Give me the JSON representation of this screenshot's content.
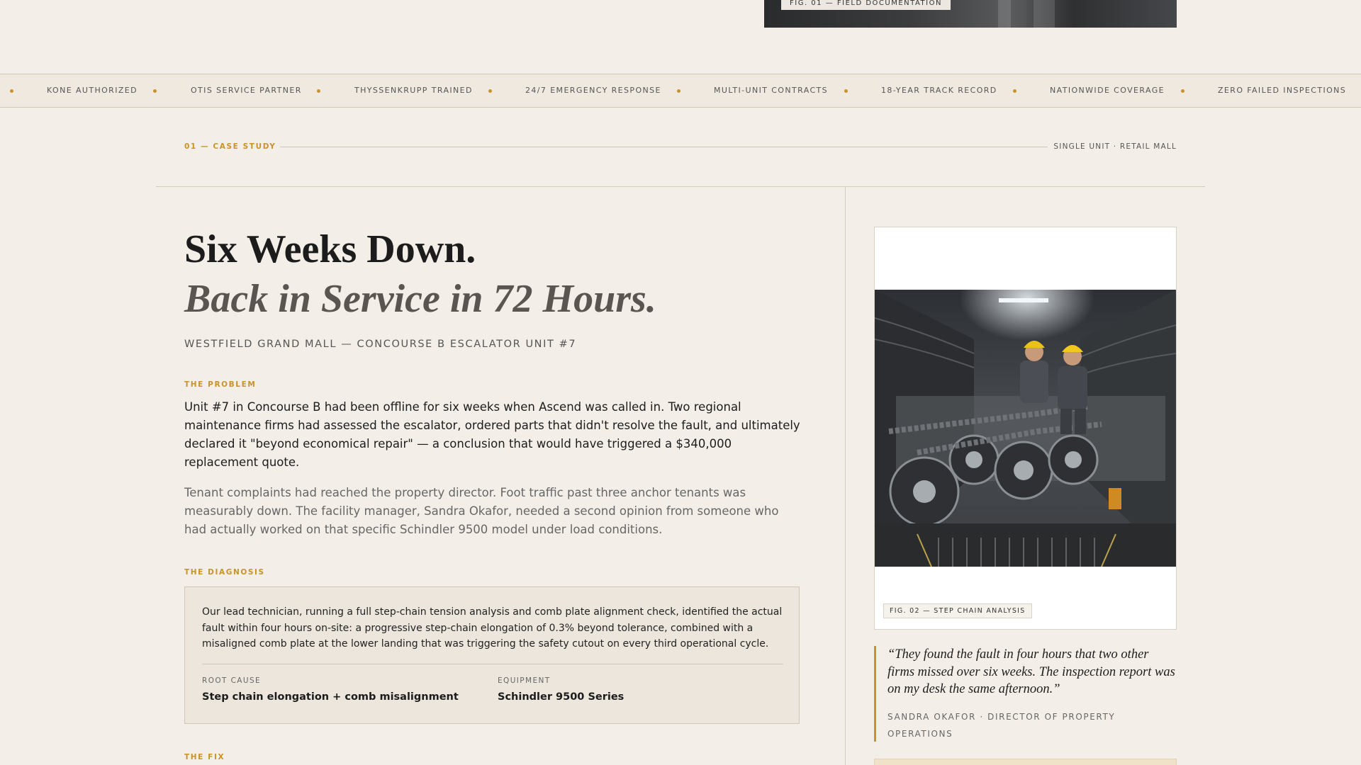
{
  "fig01": {
    "tag": "FIG. 01 — FIELD DOCUMENTATION"
  },
  "marquee": {
    "items": [
      "KONE AUTHORIZED",
      "OTIS SERVICE PARTNER",
      "THYSSENKRUPP TRAINED",
      "24/7 EMERGENCY RESPONSE",
      "MULTI-UNIT CONTRACTS",
      "18-YEAR TRACK RECORD",
      "NATIONWIDE COVERAGE",
      "ZERO FAILED INSPECTIONS"
    ],
    "dot_color": "#c9922a"
  },
  "section": {
    "label": "01 — CASE STUDY",
    "meta": "SINGLE UNIT · RETAIL MALL"
  },
  "headline": {
    "line1": "Six Weeks Down.",
    "line2": "Back in Service in 72 Hours."
  },
  "subtitle": "WESTFIELD GRAND MALL — CONCOURSE B ESCALATOR UNIT #7",
  "problem": {
    "label": "THE PROBLEM",
    "p1": "Unit #7 in Concourse B had been offline for six weeks when Ascend was called in. Two regional maintenance firms had assessed the escalator, ordered parts that didn't resolve the fault, and ultimately declared it \"beyond economical repair\" — a conclusion that would have triggered a $340,000 replacement quote.",
    "p2": "Tenant complaints had reached the property director. Foot traffic past three anchor tenants was measurably down. The facility manager, Sandra Okafor, needed a second opinion from someone who had actually worked on that specific Schindler 9500 model under load conditions."
  },
  "diagnosis": {
    "label": "THE DIAGNOSIS",
    "text": "Our lead technician, running a full step-chain tension analysis and comb plate alignment check, identified the actual fault within four hours on-site: a progressive step-chain elongation of 0.3% beyond tolerance, combined with a misaligned comb plate at the lower landing that was triggering the safety cutout on every third operational cycle.",
    "root_cause_key": "ROOT CAUSE",
    "root_cause_value": "Step chain elongation + comb misalignment",
    "equipment_key": "EQUIPMENT",
    "equipment_value": "Schindler 9500 Series"
  },
  "fix": {
    "label": "THE FIX"
  },
  "fig02": {
    "tag": "FIG. 02 — STEP CHAIN ANALYSIS"
  },
  "testimonial": {
    "quote": "“They found the fault in four hours that two other firms missed over six weeks. The inspection report was on my desk the same afternoon.”",
    "attribution": "SANDRA OKAFOR · DIRECTOR OF PROPERTY OPERATIONS"
  },
  "colors": {
    "accent": "#c9922a",
    "background": "#f3efe8"
  }
}
